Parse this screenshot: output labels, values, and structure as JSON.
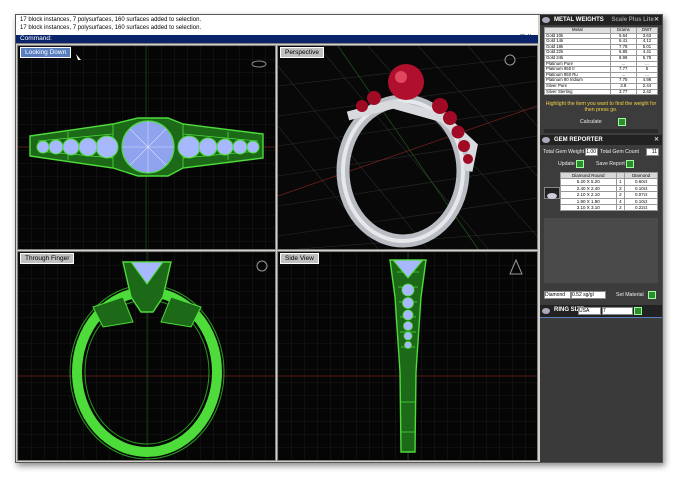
{
  "command_history": [
    "17 block instances, 7 polysurfaces, 160 surfaces added to selection.",
    "17 block instances, 7 polysurfaces, 160 surfaces added to selection."
  ],
  "command_prompt": "Command:",
  "viewports": {
    "top_left": "Looking Down",
    "top_right": "Perspective",
    "bottom_left": "Through Finger",
    "bottom_right": "Side View"
  },
  "metal_weights": {
    "title": "METAL WEIGHTS",
    "tab2": "Scale Plus Lite",
    "columns": [
      "Metal",
      "Grams",
      "DWT"
    ],
    "rows": [
      [
        "Gold 10k",
        "5.64",
        "3.63"
      ],
      [
        "Gold 14k",
        "6.41",
        "4.12"
      ],
      [
        "Gold 18k",
        "7.78",
        "5.01"
      ],
      [
        "Gold 22k",
        "6.85",
        "4.41"
      ],
      [
        "Gold 24k",
        "8.98",
        "5.78"
      ],
      [
        "Platinum Pure",
        "...",
        "..."
      ],
      [
        "Platinum 950 Ir",
        "7.77",
        "5"
      ],
      [
        "Platinum 950 Ru",
        "...",
        "..."
      ],
      [
        "Platinum 90 Iridium",
        "7.75",
        "4.98"
      ],
      [
        "Silver Pure",
        "3.8",
        "2.44"
      ],
      [
        "Silver Sterling",
        "3.77",
        "2.42"
      ]
    ],
    "hint": "Highlight the item you want to find the weight for then press go.",
    "calculate_label": "Calculate"
  },
  "gem_reporter": {
    "title": "GEM REPORTER",
    "total_weight_label": "Total Gem Weight",
    "total_weight_value": "1.00",
    "total_count_label": "Total Gem Count",
    "total_count_value": "11",
    "update_label": "Update",
    "save_report_label": "Save Report",
    "columns": [
      "Diamond Round",
      "",
      "Diamond"
    ],
    "rows": [
      [
        "5.20 X 5.20",
        "1",
        "0.60ct"
      ],
      [
        "2.40 X 2.40",
        "2",
        "0.10ct"
      ],
      [
        "2.10 X 2.10",
        "2",
        "0.07ct"
      ],
      [
        "1.90 X 1.90",
        "4",
        "0.10ct"
      ],
      [
        "3.10 X 3.10",
        "2",
        "0.22ct"
      ]
    ],
    "stone_select": "Diamond",
    "stone_weight": "0.52 sg/gl",
    "set_material_label": "Set Material"
  },
  "ring_size": {
    "label": "RING SIZE",
    "country": "USA",
    "value": "7"
  },
  "colors": {
    "wire_green": "#4ddc3a",
    "gem_blue": "#a8b8ff",
    "ruby": "#b0102e",
    "panel_bg": "#3c3c3c",
    "button_green": "#2e8b2e",
    "hint_yellow": "#f5d142"
  }
}
